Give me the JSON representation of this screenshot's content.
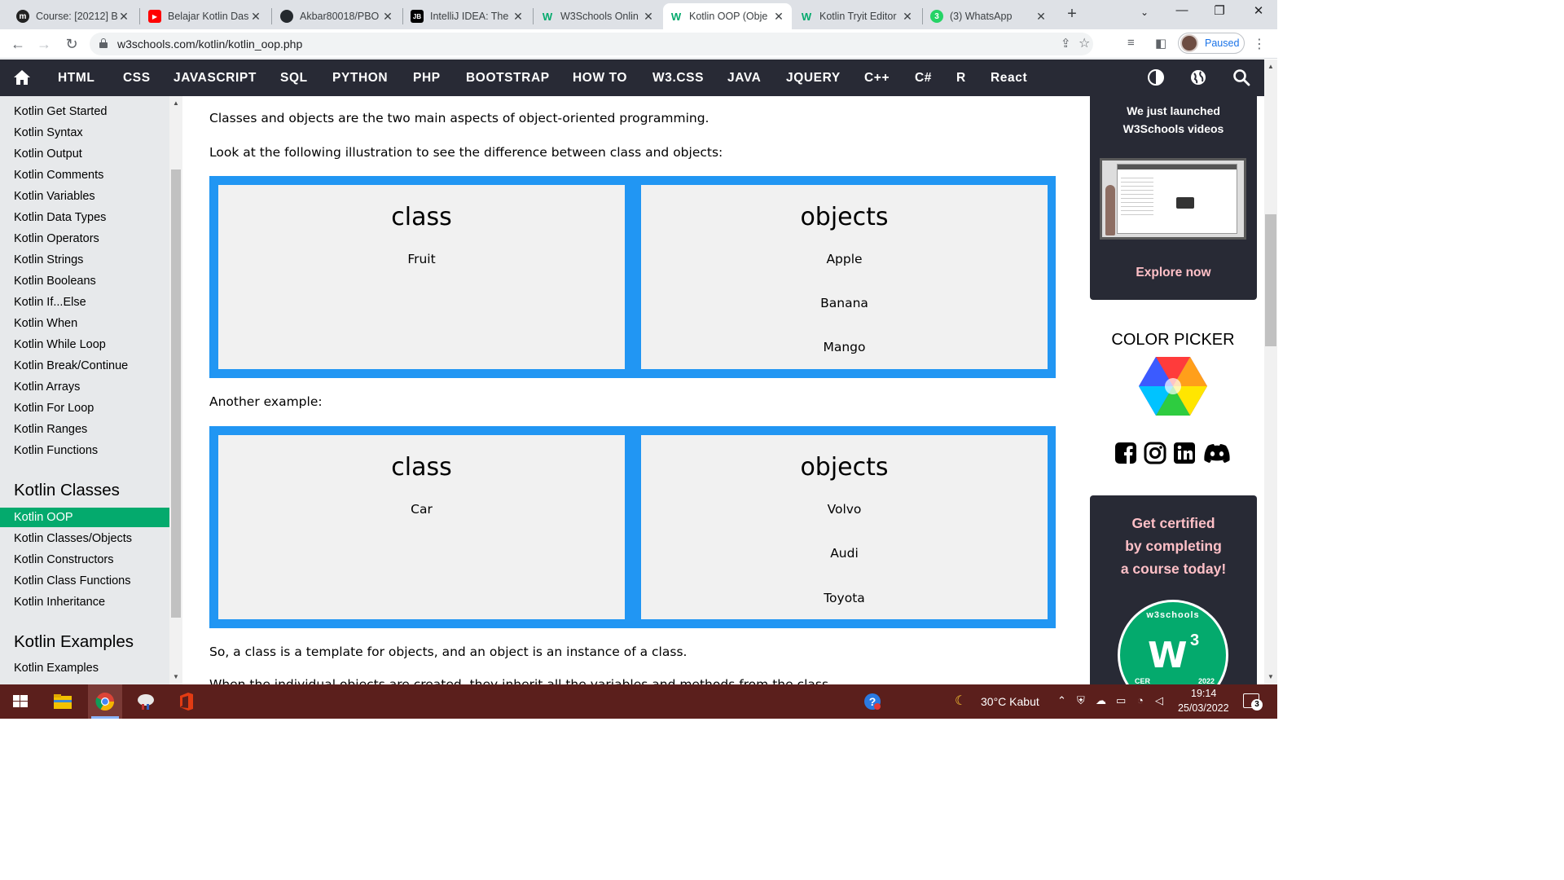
{
  "browser": {
    "tabs": [
      {
        "title": "Course: [20212] B",
        "fav_text": "m",
        "fav_color": "#222222"
      },
      {
        "title": "Belajar Kotlin Das",
        "fav_text": "▶",
        "fav_color": "#ff0000"
      },
      {
        "title": "Akbar80018/PBO",
        "fav_text": "●",
        "fav_color": "#24292e"
      },
      {
        "title": "IntelliJ IDEA: The",
        "fav_text": "JB",
        "fav_color": "#000000"
      },
      {
        "title": "W3Schools Onlin",
        "fav_text": "W",
        "fav_color": "#04aa6d"
      },
      {
        "title": "Kotlin OOP (Obje",
        "fav_text": "W",
        "fav_color": "#04aa6d"
      },
      {
        "title": "Kotlin Tryit Editor",
        "fav_text": "W",
        "fav_color": "#04aa6d"
      },
      {
        "title": "(3) WhatsApp",
        "fav_text": "3",
        "fav_color": "#25d366"
      }
    ],
    "active_tab": 5,
    "url": "w3schools.com/kotlin/kotlin_oop.php",
    "profile_status": "Paused"
  },
  "w3nav": {
    "links": [
      "HTML",
      "CSS",
      "JAVASCRIPT",
      "SQL",
      "PYTHON",
      "PHP",
      "BOOTSTRAP",
      "HOW TO",
      "W3.CSS",
      "JAVA",
      "JQUERY",
      "C++",
      "C#",
      "R",
      "React"
    ]
  },
  "sidebar": {
    "items_top": [
      "Kotlin Get Started",
      "Kotlin Syntax",
      "Kotlin Output",
      "Kotlin Comments",
      "Kotlin Variables",
      "Kotlin Data Types",
      "Kotlin Operators",
      "Kotlin Strings",
      "Kotlin Booleans",
      "Kotlin If...Else",
      "Kotlin When",
      "Kotlin While Loop",
      "Kotlin Break/Continue",
      "Kotlin Arrays",
      "Kotlin For Loop",
      "Kotlin Ranges",
      "Kotlin Functions"
    ],
    "heading_classes": "Kotlin Classes",
    "items_classes": [
      "Kotlin OOP",
      "Kotlin Classes/Objects",
      "Kotlin Constructors",
      "Kotlin Class Functions",
      "Kotlin Inheritance"
    ],
    "active_item": "Kotlin OOP",
    "heading_examples": "Kotlin Examples",
    "items_examples": [
      "Kotlin Examples"
    ]
  },
  "main": {
    "intro": "Classes and objects are the two main aspects of object-oriented programming.",
    "look_at": "Look at the following illustration to see the difference between class and objects:",
    "illustration1": {
      "class_title": "class",
      "class_item": "Fruit",
      "objects_title": "objects",
      "objects": [
        "Apple",
        "Banana",
        "Mango"
      ]
    },
    "another": "Another example:",
    "illustration2": {
      "class_title": "class",
      "class_item": "Car",
      "objects_title": "objects",
      "objects": [
        "Volvo",
        "Audi",
        "Toyota"
      ]
    },
    "so_text": "So, a class is a template for objects, and an object is an instance of a class.",
    "cut_text": "When the individual objects are created, they inherit all the variables and methods from the class."
  },
  "rightbar": {
    "video_line1": "We just launched",
    "video_line2": "W3Schools videos",
    "video_link": "Explore now",
    "color_picker": "COLOR PICKER",
    "cert_line1": "Get certified",
    "cert_line2": "by completing",
    "cert_line3": "a course today!",
    "badge_text": "w3schools",
    "badge_year": "2022",
    "badge_left": "CER"
  },
  "taskbar": {
    "weather": "30°C  Kabut",
    "time": "19:14",
    "date": "25/03/2022",
    "notifications": "3"
  },
  "colors": {
    "w3_green": "#04aa6d",
    "illustration_blue": "#2196f3",
    "nav_dark": "#282a35",
    "promo_pink": "#ffc0c7",
    "taskbar": "#5b1f1c"
  }
}
